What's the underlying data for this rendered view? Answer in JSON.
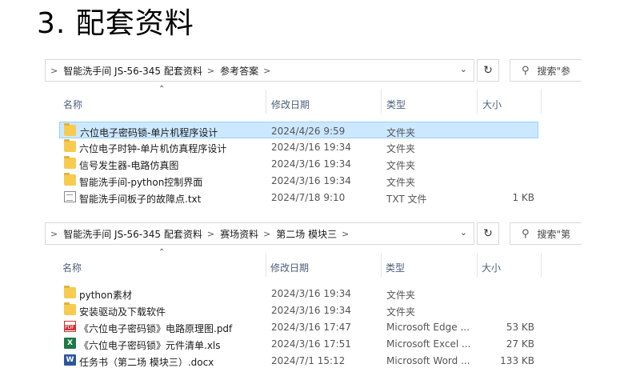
{
  "heading": "3. 配套资料",
  "explorer1": {
    "path": [
      "智能洗手间 JS-56-345 配套资料",
      "参考答案"
    ],
    "search_placeholder": "搜索\"参",
    "columns": {
      "name": "名称",
      "date": "修改日期",
      "type": "类型",
      "size": "大小"
    },
    "rows": [
      {
        "icon": "folder-icon",
        "name": "六位电子密码锁-单片机程序设计",
        "date": "2024/4/26 9:59",
        "type": "文件夹",
        "size": "",
        "selected": true
      },
      {
        "icon": "folder-icon",
        "name": "六位电子时钟-单片机仿真程序设计",
        "date": "2024/3/16 19:34",
        "type": "文件夹",
        "size": ""
      },
      {
        "icon": "folder-icon",
        "name": "信号发生器-电路仿真图",
        "date": "2024/3/16 19:34",
        "type": "文件夹",
        "size": ""
      },
      {
        "icon": "folder-icon",
        "name": "智能洗手间-python控制界面",
        "date": "2024/3/16 19:34",
        "type": "文件夹",
        "size": ""
      },
      {
        "icon": "txt-file-icon",
        "name": "智能洗手间板子的故障点.txt",
        "date": "2024/7/18 9:10",
        "type": "TXT 文件",
        "size": "1 KB"
      }
    ]
  },
  "explorer2": {
    "path": [
      "智能洗手间 JS-56-345 配套资料",
      "赛场资料",
      "第二场 模块三"
    ],
    "search_placeholder": "搜索\"第",
    "columns": {
      "name": "名称",
      "date": "修改日期",
      "type": "类型",
      "size": "大小"
    },
    "rows": [
      {
        "icon": "folder-icon",
        "name": "python素材",
        "date": "2024/3/16 19:34",
        "type": "文件夹",
        "size": ""
      },
      {
        "icon": "folder-icon",
        "name": "安装驱动及下载软件",
        "date": "2024/3/16 19:34",
        "type": "文件夹",
        "size": ""
      },
      {
        "icon": "pdf-file-icon",
        "name": "《六位电子密码锁》电路原理图.pdf",
        "date": "2024/3/16 17:47",
        "type": "Microsoft Edge ...",
        "size": "53 KB"
      },
      {
        "icon": "excel-file-icon",
        "name": "《六位电子密码锁》元件清单.xls",
        "date": "2024/3/16 17:51",
        "type": "Microsoft Excel ...",
        "size": "27 KB"
      },
      {
        "icon": "word-file-icon",
        "name": "任务书（第二场 模块三）.docx",
        "date": "2024/7/1 15:12",
        "type": "Microsoft Word ...",
        "size": "133 KB"
      }
    ]
  }
}
